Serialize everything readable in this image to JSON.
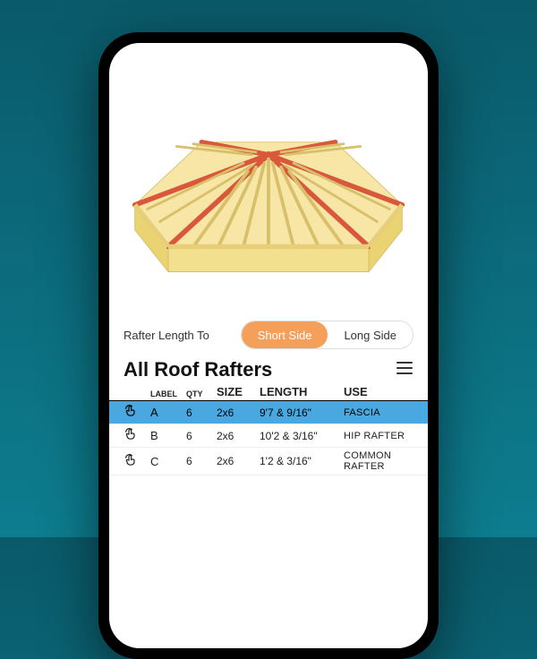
{
  "controls": {
    "label": "Rafter Length To",
    "options": [
      "Short Side",
      "Long Side"
    ],
    "active": 0
  },
  "section": {
    "title": "All Roof Rafters"
  },
  "columns": {
    "label": "LABEL",
    "qty": "QTY",
    "size": "SIZE",
    "length": "LENGTH",
    "use": "USE"
  },
  "rows": [
    {
      "label": "A",
      "qty": "6",
      "size": "2x6",
      "length": "9'7 & 9/16\"",
      "use": "FASCIA",
      "selected": true
    },
    {
      "label": "B",
      "qty": "6",
      "size": "2x6",
      "length": "10'2 & 3/16\"",
      "use": "HIP RAFTER",
      "selected": false
    },
    {
      "label": "C",
      "qty": "6",
      "size": "2x6",
      "length": "1'2 & 3/16\"",
      "use": "COMMON RAFTER",
      "selected": false
    }
  ]
}
